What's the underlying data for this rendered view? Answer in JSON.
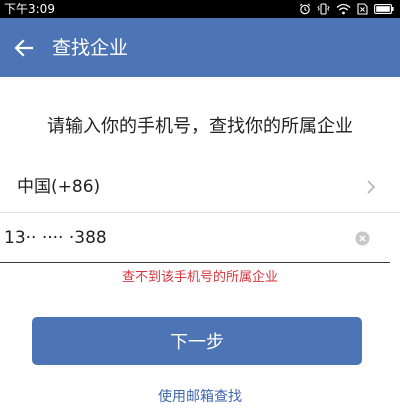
{
  "status_bar": {
    "time": "下午3:09",
    "icons": [
      "alarm-icon",
      "vibrate-icon",
      "wifi-icon",
      "sim-icon",
      "battery-icon"
    ]
  },
  "header": {
    "back_icon": "arrow-left-icon",
    "title": "查找企业"
  },
  "main": {
    "prompt": "请输入你的手机号，查找你的所属企业",
    "country": {
      "label": "中国(+86)",
      "chevron_icon": "chevron-right-icon"
    },
    "phone": {
      "value": "13·· ···· ·388",
      "clear_icon": "clear-icon"
    },
    "error": "查不到该手机号的所属企业",
    "next_button": "下一步",
    "email_link": "使用邮箱查找"
  },
  "colors": {
    "primary": "#4d74b5",
    "error": "#d9363e",
    "link": "#3f67ad"
  }
}
